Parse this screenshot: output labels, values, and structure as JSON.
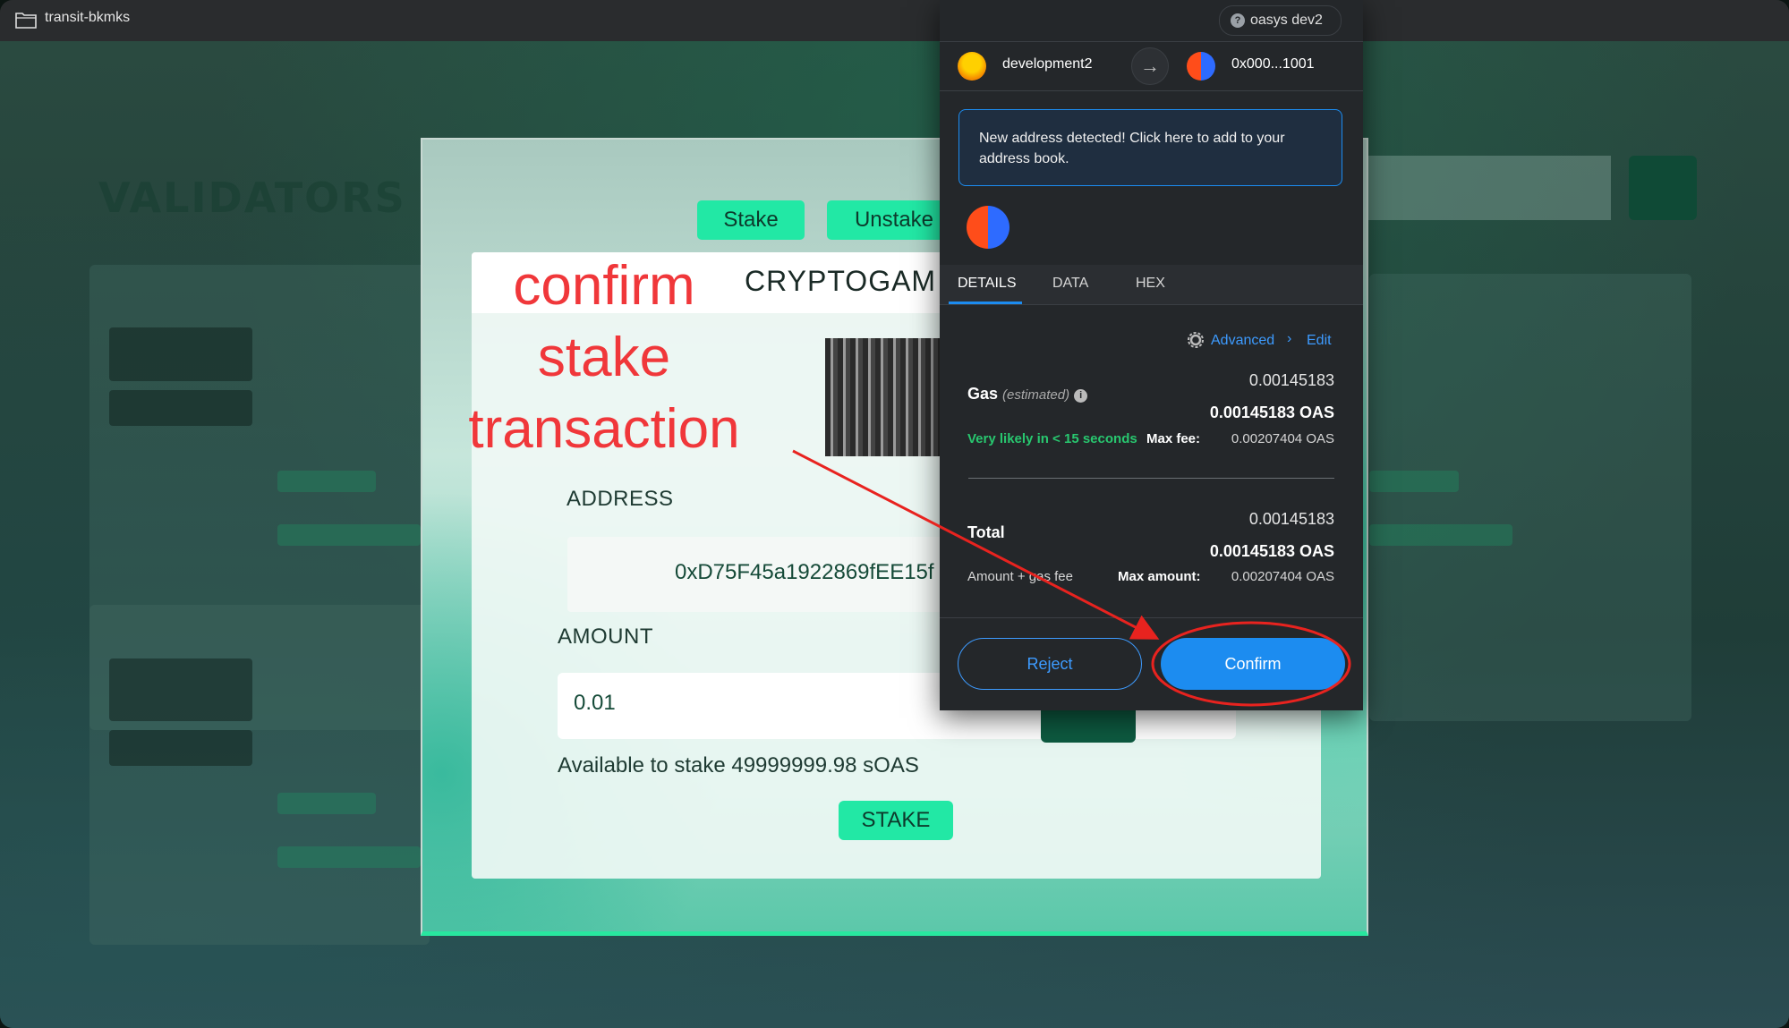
{
  "window": {
    "title": "transit-bkmks"
  },
  "background": {
    "page_heading": "VALIDATORS"
  },
  "stake_modal": {
    "tabs": [
      {
        "label": "Stake"
      },
      {
        "label": "Unstake"
      }
    ],
    "validator_name": "CRYPTOGAM",
    "address_label": "ADDRESS",
    "address_value": "0xD75F45a1922869fEE15f",
    "amount_label": "AMOUNT",
    "amount_value": "0.01",
    "available": "Available to stake 49999999.98 sOAS",
    "submit_label": "STAKE"
  },
  "annotation": {
    "lines": [
      "confirm",
      "stake",
      "transaction"
    ],
    "color": "#f0373a"
  },
  "metamask": {
    "network": "oasys dev2",
    "from_account": "development2",
    "to_account": "0x000...1001",
    "notice": "New address detected! Click here to add to your address book.",
    "tabs": [
      "DETAILS",
      "DATA",
      "HEX"
    ],
    "active_tab": "DETAILS",
    "advanced_link": "Advanced",
    "edit_link": "Edit",
    "gas": {
      "label": "Gas",
      "estimated_label": "(estimated)",
      "value": "0.00145183",
      "value_bold": "0.00145183 OAS",
      "speed": "Very likely in < 15 seconds",
      "max_fee_label": "Max fee:",
      "max_fee_value": "0.00207404 OAS"
    },
    "total": {
      "label": "Total",
      "value": "0.00145183",
      "value_bold": "0.00145183 OAS",
      "sub_label": "Amount + gas fee",
      "max_amount_label": "Max amount:",
      "max_amount_value": "0.00207404 OAS"
    },
    "reject_label": "Reject",
    "confirm_label": "Confirm",
    "accent_color": "#1c8cf0"
  }
}
